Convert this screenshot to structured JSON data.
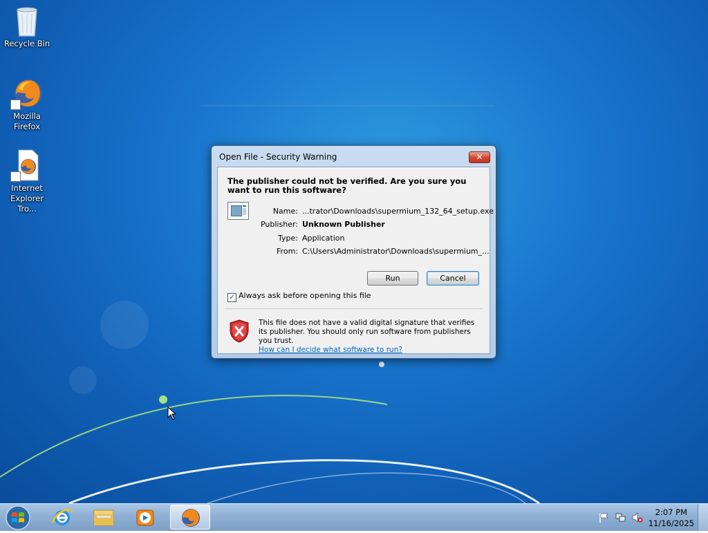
{
  "desktop": {
    "icons": [
      {
        "label": "Recycle Bin",
        "icon": "recycle-bin-icon"
      },
      {
        "label": "Mozilla Firefox",
        "icon": "firefox-icon"
      },
      {
        "label": "Internet Explorer Tro...",
        "icon": "firefox-document-icon"
      }
    ]
  },
  "dialog": {
    "title": "Open File - Security Warning",
    "close_label": "✕",
    "question": "The publisher could not be verified.  Are you sure you want to run this software?",
    "fields": [
      {
        "label": "Name:",
        "value": "...trator\\Downloads\\supermium_132_64_setup.exe"
      },
      {
        "label": "Publisher:",
        "value": "Unknown Publisher"
      },
      {
        "label": "Type:",
        "value": "Application"
      },
      {
        "label": "From:",
        "value": "C:\\Users\\Administrator\\Downloads\\supermium_..."
      }
    ],
    "run_label": "Run",
    "cancel_label": "Cancel",
    "always_ask_label": "Always ask before opening this file",
    "always_ask_checked": true,
    "warning_text": "This file does not have a valid digital signature that verifies its publisher.  You should only run software from publishers you trust.",
    "help_link": "How can I decide what software to run?"
  },
  "taskbar": {
    "items": [
      {
        "icon": "internet-explorer-icon",
        "active": false
      },
      {
        "icon": "windows-explorer-icon",
        "active": false
      },
      {
        "icon": "media-player-icon",
        "active": false
      },
      {
        "icon": "firefox-icon",
        "active": true
      }
    ],
    "tray": {
      "icons": [
        "action-center-flag-icon",
        "network-icon",
        "volume-muted-icon"
      ],
      "time": "2:07 PM",
      "date": "11/16/2025"
    }
  },
  "colors": {
    "desktop_blue": "#1a78cf",
    "link": "#0066cc",
    "close_red": "#d1472f"
  }
}
